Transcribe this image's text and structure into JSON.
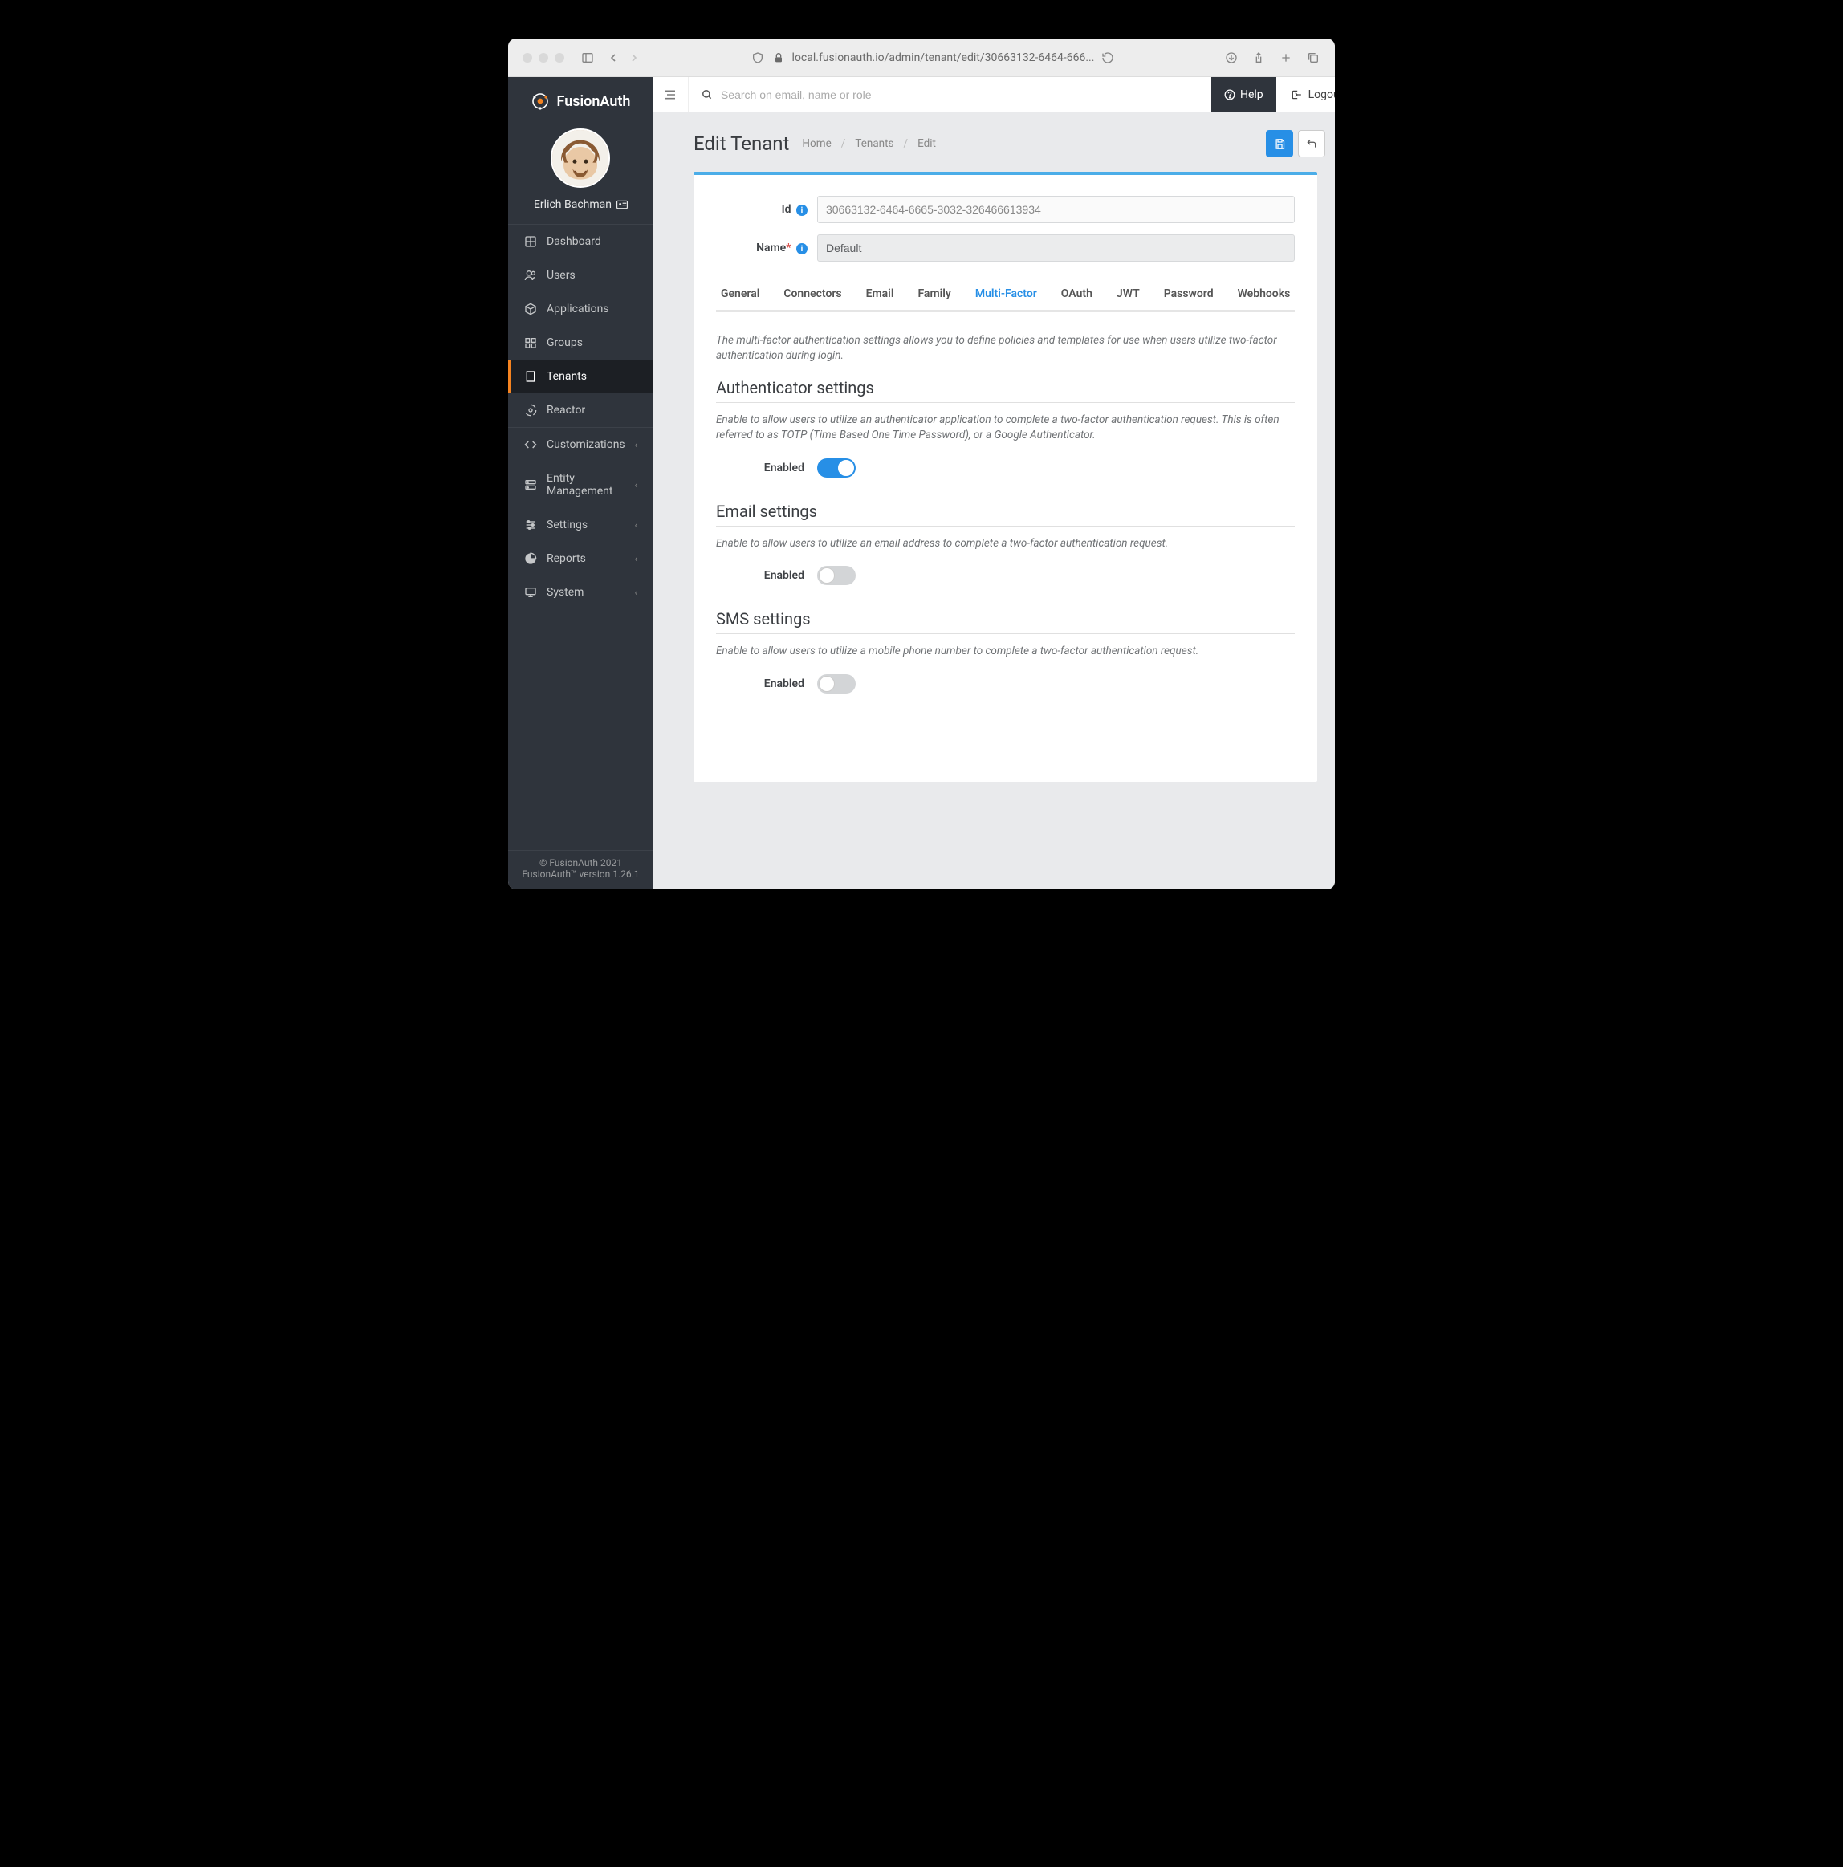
{
  "browser": {
    "url": "local.fusionauth.io/admin/tenant/edit/30663132-6464-666..."
  },
  "brand": {
    "name": "FusionAuth"
  },
  "user": {
    "name": "Erlich Bachman"
  },
  "sidebar": {
    "primary": [
      {
        "label": "Dashboard",
        "icon": "dashboard"
      },
      {
        "label": "Users",
        "icon": "users"
      },
      {
        "label": "Applications",
        "icon": "cube"
      },
      {
        "label": "Groups",
        "icon": "groups"
      },
      {
        "label": "Tenants",
        "icon": "building",
        "active": true
      },
      {
        "label": "Reactor",
        "icon": "reactor"
      }
    ],
    "secondary": [
      {
        "label": "Customizations",
        "icon": "code"
      },
      {
        "label": "Entity Management",
        "icon": "server"
      },
      {
        "label": "Settings",
        "icon": "sliders"
      },
      {
        "label": "Reports",
        "icon": "pie"
      },
      {
        "label": "System",
        "icon": "monitor"
      }
    ],
    "footer": {
      "copyright": "© FusionAuth 2021",
      "version": "FusionAuth™ version 1.26.1"
    }
  },
  "topbar": {
    "search_placeholder": "Search on email, name or role",
    "help": "Help",
    "logout": "Logout"
  },
  "page": {
    "title": "Edit Tenant",
    "breadcrumbs": [
      "Home",
      "Tenants",
      "Edit"
    ]
  },
  "form": {
    "id_label": "Id",
    "id_value": "30663132-6464-6665-3032-326466613934",
    "name_label": "Name",
    "name_value": "Default"
  },
  "tabs": [
    "General",
    "Connectors",
    "Email",
    "Family",
    "Multi-Factor",
    "OAuth",
    "JWT",
    "Password",
    "Webhooks"
  ],
  "active_tab": "Multi-Factor",
  "mfa": {
    "intro": "The multi-factor authentication settings allows you to define policies and templates for use when users utilize two-factor authentication during login.",
    "authenticator": {
      "title": "Authenticator settings",
      "desc": "Enable to allow users to utilize an authenticator application to complete a two-factor authentication request. This is often referred to as TOTP (Time Based One Time Password), or a Google Authenticator.",
      "enabled_label": "Enabled",
      "enabled": true
    },
    "email": {
      "title": "Email settings",
      "desc": "Enable to allow users to utilize an email address to complete a two-factor authentication request.",
      "enabled_label": "Enabled",
      "enabled": false
    },
    "sms": {
      "title": "SMS settings",
      "desc": "Enable to allow users to utilize a mobile phone number to complete a two-factor authentication request.",
      "enabled_label": "Enabled",
      "enabled": false
    }
  }
}
